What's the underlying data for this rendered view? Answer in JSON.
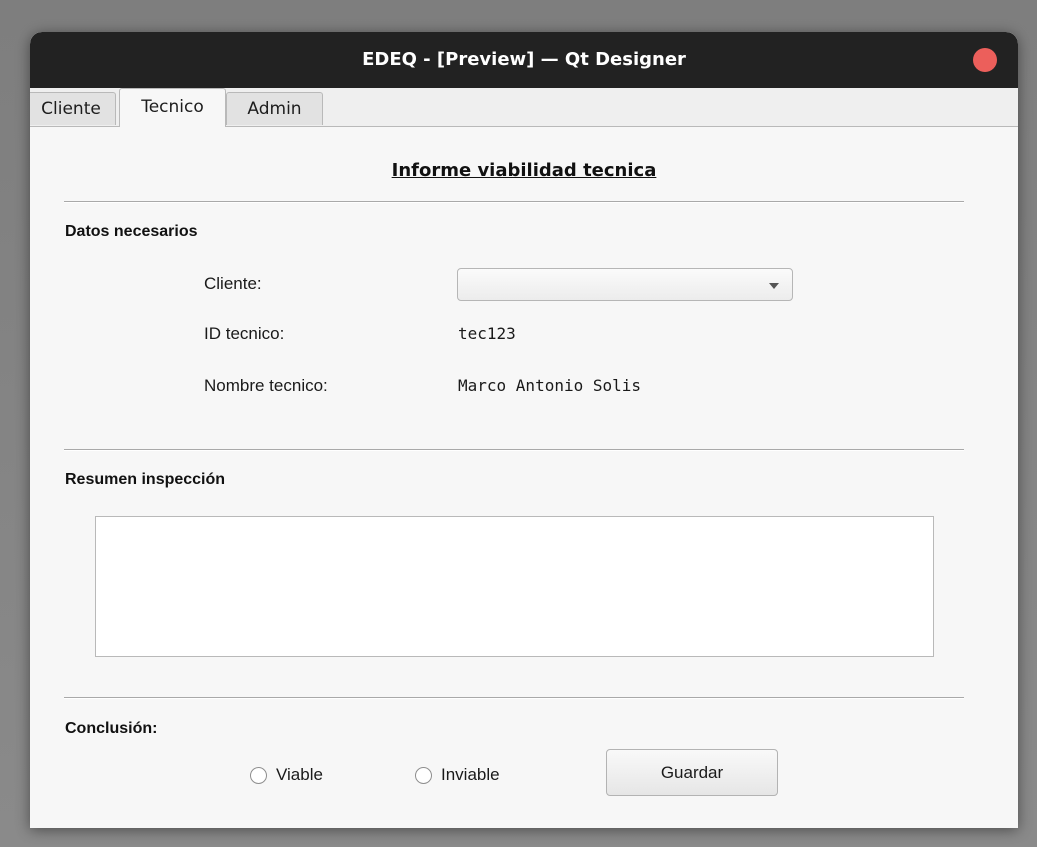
{
  "window": {
    "title": "EDEQ - [Preview] — Qt Designer",
    "close_color": "#ec5f5b"
  },
  "tabs": [
    {
      "label": "Cliente",
      "selected": false
    },
    {
      "label": "Tecnico",
      "selected": true
    },
    {
      "label": "Admin",
      "selected": false
    }
  ],
  "report": {
    "title": "Informe viabilidad tecnica"
  },
  "datos": {
    "heading": "Datos necesarios",
    "cliente_label": "Cliente:",
    "cliente_value": "",
    "id_label": "ID tecnico:",
    "id_value": "tec123",
    "nombre_label": "Nombre tecnico:",
    "nombre_value": "Marco Antonio Solis"
  },
  "resumen": {
    "heading": "Resumen inspección",
    "text": ""
  },
  "conclusion": {
    "heading": "Conclusión:",
    "option_viable": "Viable",
    "option_inviable": "Inviable",
    "save_label": "Guardar"
  },
  "icons": {
    "close": "close-icon",
    "dropdown": "chevron-down-icon",
    "radio": "radio-unchecked-icon"
  }
}
